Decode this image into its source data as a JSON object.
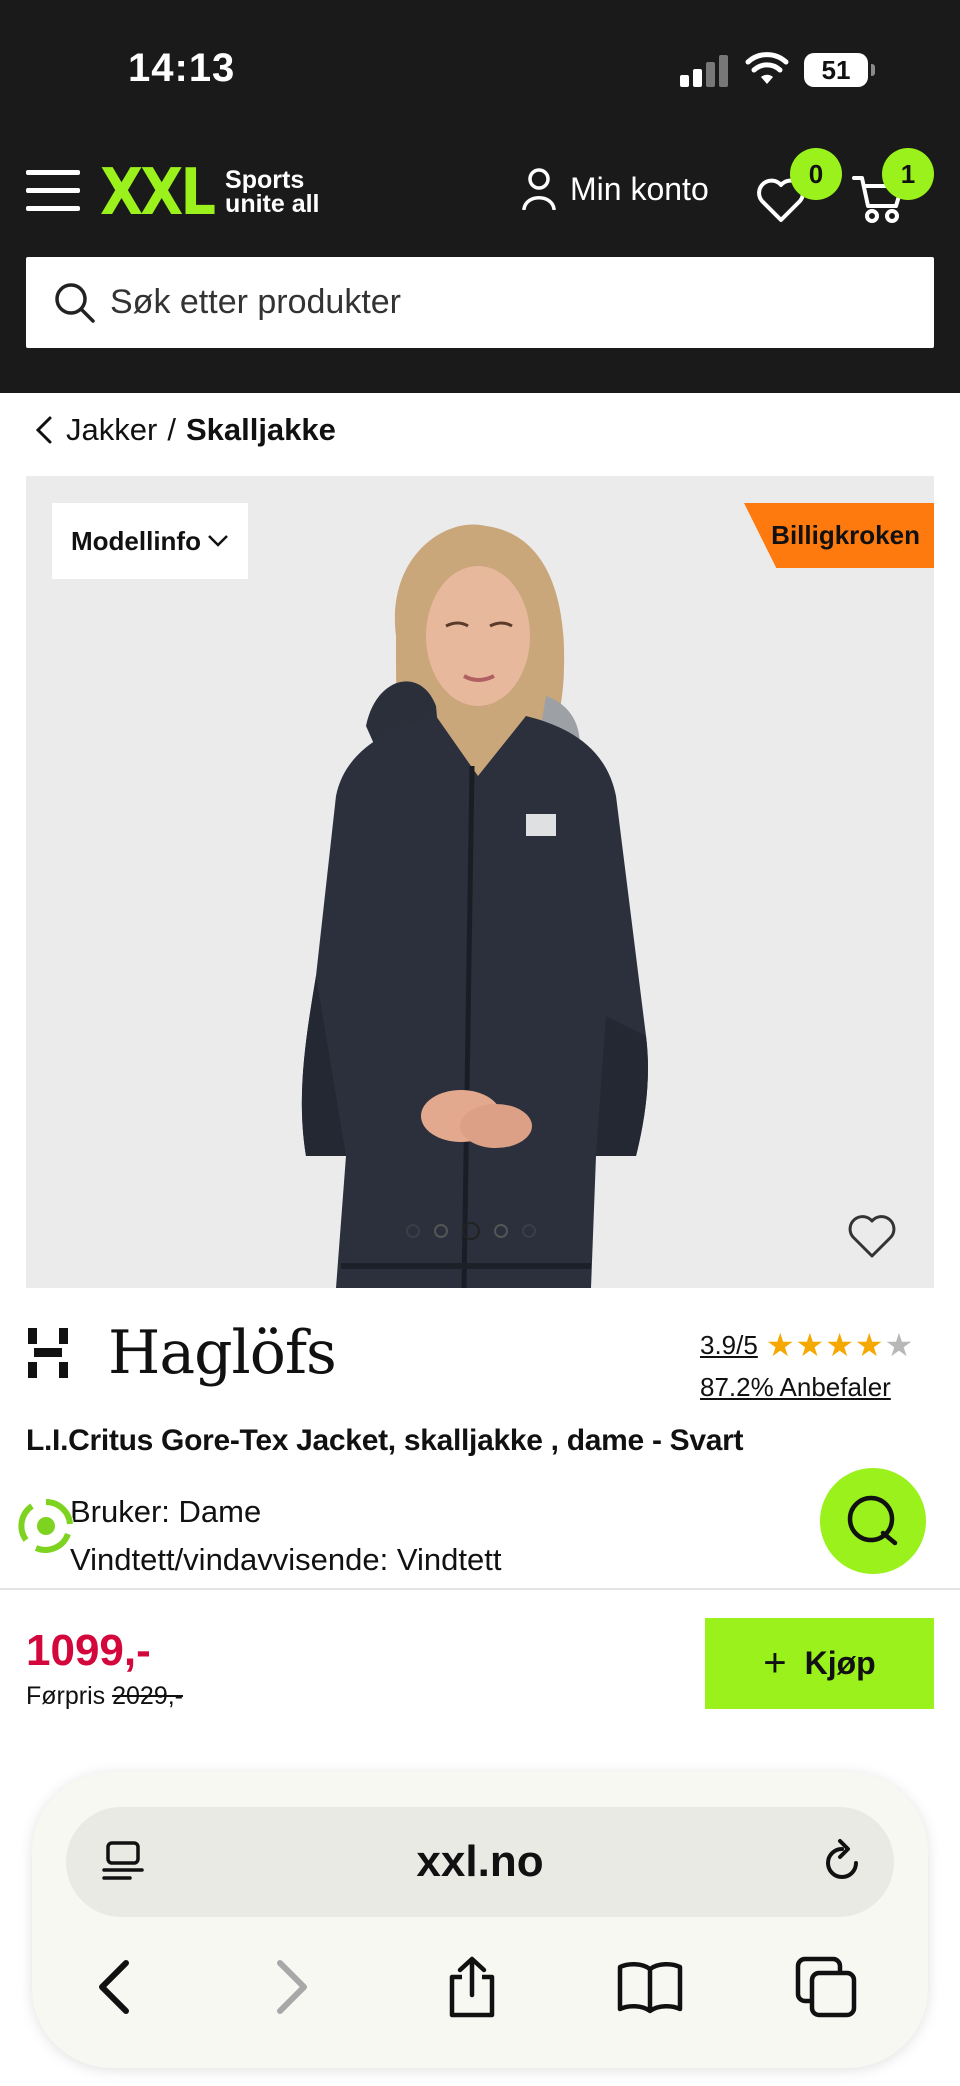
{
  "status_bar": {
    "time": "14:13",
    "battery": "51"
  },
  "header": {
    "logo_text": "XXL",
    "logo_tagline_1": "Sports",
    "logo_tagline_2": "unite all",
    "account_label": "Min konto",
    "wishlist_count": "0",
    "cart_count": "1",
    "search_placeholder": "Søk etter produkter"
  },
  "breadcrumb": {
    "parent": "Jakker",
    "separator": "/",
    "current": "Skalljakke"
  },
  "gallery": {
    "model_info_label": "Modellinfo",
    "sale_tag": "Billigkroken",
    "image_count": 5,
    "active_image": 3
  },
  "product": {
    "brand": "Haglöfs",
    "rating": "3.9/5",
    "rating_value": 3.9,
    "recommend": "87.2% Anbefaler",
    "title": "L.I.Critus Gore-Tex Jacket, skalljakke , dame - Svart",
    "specs": [
      "Bruker: Dame",
      "Vindtett/vindavvisende: Vindtett"
    ]
  },
  "buy": {
    "price": "1099,-",
    "prev_label": "Førpris",
    "prev_price": "2029,-",
    "button_label": "Kjøp"
  },
  "browser": {
    "url": "xxl.no"
  },
  "colors": {
    "accent": "#9af11b",
    "sale": "#ff7a0e",
    "price": "#d4073d",
    "header_bg": "#1a1a1a"
  }
}
